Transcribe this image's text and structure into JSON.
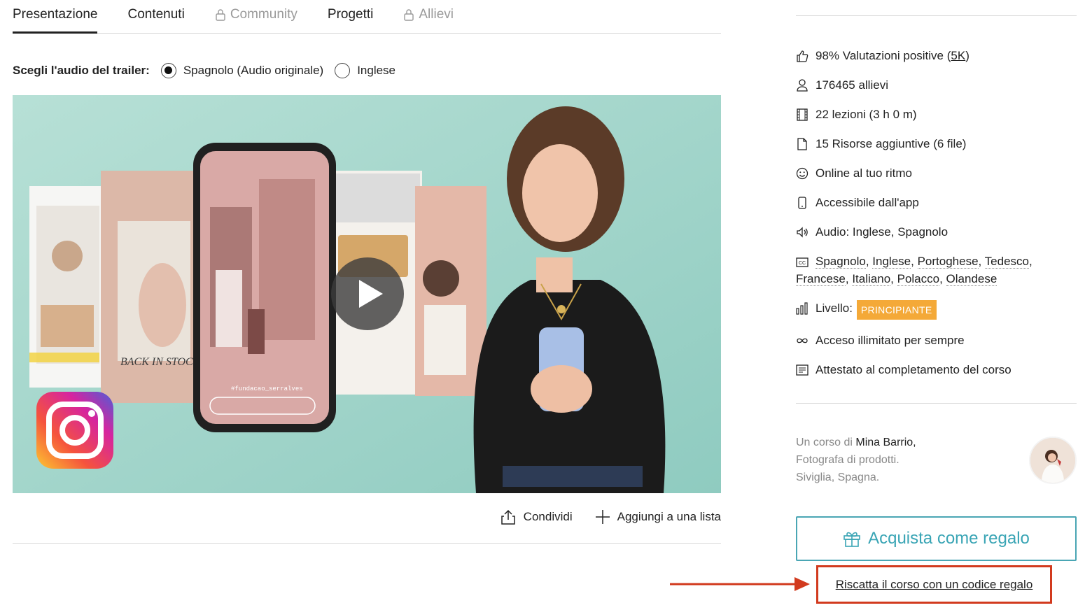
{
  "tabs": [
    {
      "label": "Presentazione",
      "active": true,
      "locked": false
    },
    {
      "label": "Contenuti",
      "active": false,
      "locked": false
    },
    {
      "label": "Community",
      "active": false,
      "locked": true
    },
    {
      "label": "Progetti",
      "active": false,
      "locked": false
    },
    {
      "label": "Allievi",
      "active": false,
      "locked": true
    }
  ],
  "audio": {
    "label": "Scegli l'audio del trailer:",
    "options": [
      {
        "label": "Spagnolo (Audio originale)",
        "selected": true
      },
      {
        "label": "Inglese",
        "selected": false
      }
    ]
  },
  "video": {
    "play_icon": "play-icon",
    "background_color": "#a9d6cc",
    "phone_caption": "#fundacao_serralves",
    "card_text": "BACK IN STOCK"
  },
  "share": {
    "share_label": "Condividi",
    "add_list_label": "Aggiungi a una lista"
  },
  "features": {
    "rating_prefix": "98% Valutazioni positive (",
    "rating_count": "5K",
    "rating_suffix": ")",
    "students": "176465 allievi",
    "lessons": "22 lezioni (3 h 0 m)",
    "resources": "15 Risorse aggiuntive (6 file)",
    "online": "Online al tuo ritmo",
    "app": "Accessibile dall'app",
    "audio": "Audio: Inglese, Spagnolo",
    "subtitles": [
      "Spagnolo",
      "Inglese",
      "Portoghese",
      "Tedesco",
      "Francese",
      "Italiano",
      "Polacco",
      "Olandese"
    ],
    "level_label": "Livello:",
    "level_value": "PRINCIPIANTE",
    "access": "Acceso illimitato per sempre",
    "certificate": "Attestato al completamento del corso"
  },
  "author": {
    "prefix": "Un corso di",
    "name": "Mina Barrio,",
    "role": "Fotografa di prodotti.",
    "location": "Siviglia, Spagna."
  },
  "gift_button": "Acquista come regalo",
  "redeem_link": "Riscatta il corso con un codice regalo",
  "colors": {
    "accent": "#3aa5b5",
    "badge": "#f4a938",
    "highlight": "#d23a1e"
  }
}
